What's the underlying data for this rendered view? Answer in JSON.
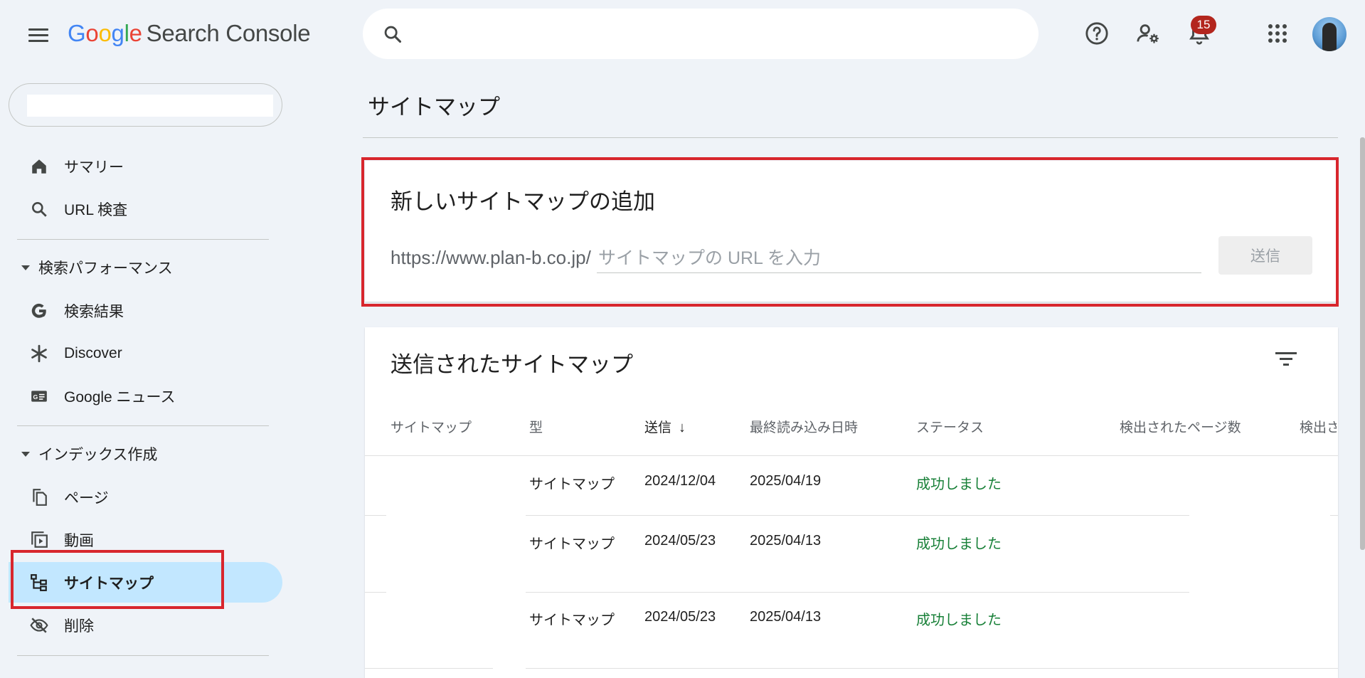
{
  "header": {
    "menu_icon": "menu-icon",
    "logo_google": [
      "G",
      "o",
      "o",
      "g",
      "l",
      "e"
    ],
    "product_name": "Search Console",
    "search_placeholder": "",
    "notification_count": "15",
    "icons": [
      "help-icon",
      "manage-users-icon",
      "notifications-icon",
      "apps-grid-icon",
      "avatar"
    ]
  },
  "sidebar": {
    "property_value": "",
    "items_top": [
      {
        "label": "サマリー",
        "icon": "home-icon"
      },
      {
        "label": "URL 検査",
        "icon": "search-icon"
      }
    ],
    "section_performance": "検索パフォーマンス",
    "items_performance": [
      {
        "label": "検索結果",
        "icon": "google-g-icon"
      },
      {
        "label": "Discover",
        "icon": "asterisk-icon"
      },
      {
        "label": "Google ニュース",
        "icon": "google-news-icon"
      }
    ],
    "section_index": "インデックス作成",
    "items_index": [
      {
        "label": "ページ",
        "icon": "pages-icon"
      },
      {
        "label": "動画",
        "icon": "video-icon"
      },
      {
        "label": "サイトマップ",
        "icon": "sitemap-icon",
        "active": true
      },
      {
        "label": "削除",
        "icon": "visibility-off-icon"
      }
    ]
  },
  "main": {
    "page_title": "サイトマップ",
    "add_card": {
      "title": "新しいサイトマップの追加",
      "url_prefix": "https://www.plan-b.co.jp/",
      "input_placeholder": "サイトマップの URL を入力",
      "input_value": "",
      "submit_label": "送信"
    },
    "submitted_card": {
      "title": "送信されたサイトマップ",
      "filter_icon": "filter-icon",
      "columns": [
        "サイトマップ",
        "型",
        "送信",
        "最終読み込み日時",
        "ステータス",
        "検出されたページ数",
        "検出さ"
      ],
      "sorted_column": "送信",
      "sort_direction_icon": "↓",
      "rows": [
        {
          "sitemap": "",
          "type": "サイトマップ",
          "submitted": "2024/12/04",
          "last_read": "2025/04/19",
          "status": "成功しました",
          "pages": ""
        },
        {
          "sitemap": "",
          "type": "サイトマップ",
          "submitted": "2024/05/23",
          "last_read": "2025/04/13",
          "status": "成功しました",
          "pages": ""
        },
        {
          "sitemap": "",
          "type": "サイトマップ",
          "submitted": "2024/05/23",
          "last_read": "2025/04/13",
          "status": "成功しました",
          "pages": ""
        }
      ]
    }
  },
  "colors": {
    "background": "#eff3f8",
    "active_nav": "#c2e7ff",
    "highlight_red": "#d8262d",
    "status_success": "#188038",
    "badge_red": "#b3261e"
  }
}
